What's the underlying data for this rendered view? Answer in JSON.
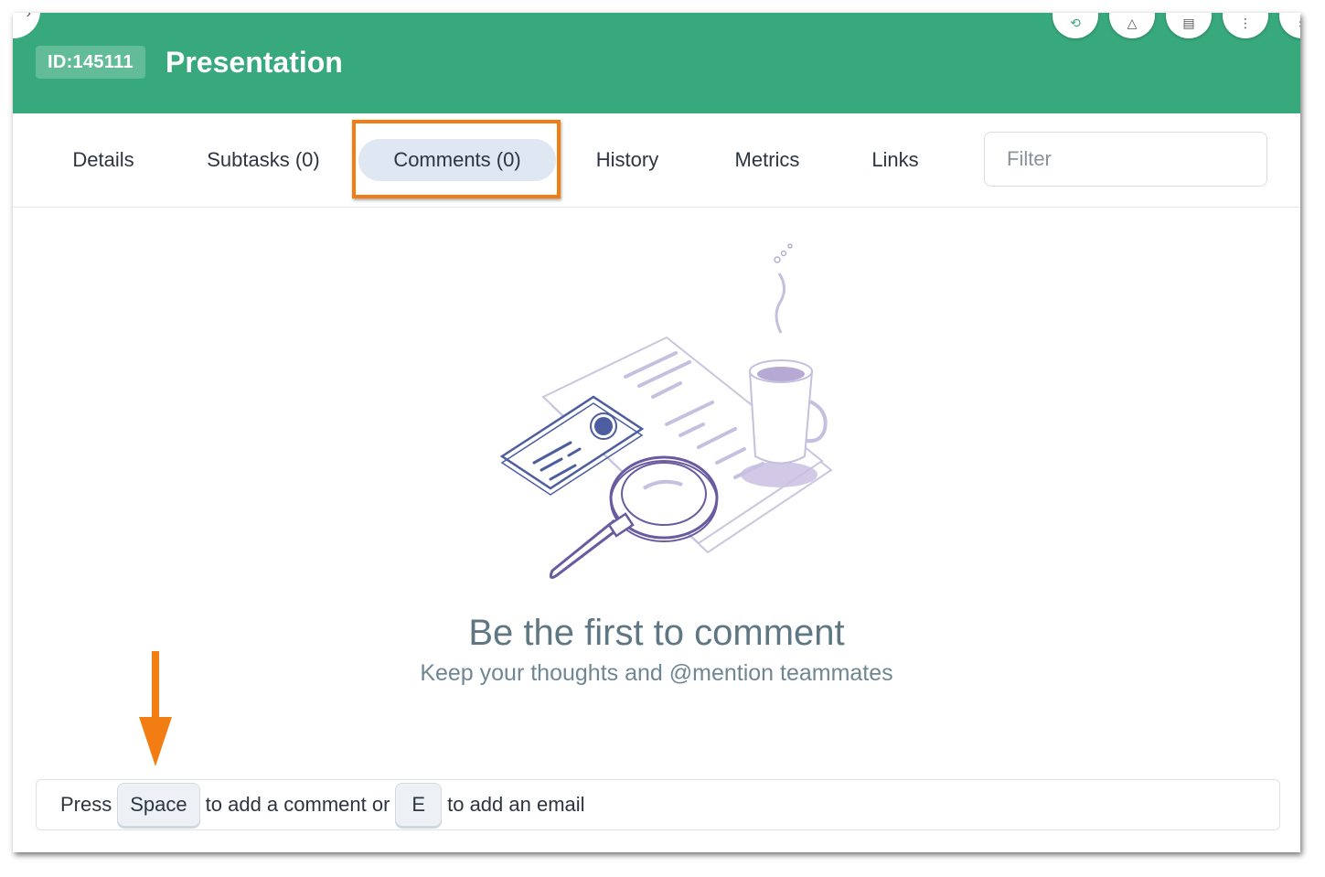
{
  "header": {
    "id_badge": "ID:145111",
    "title": "Presentation",
    "back_icon": "chevron-left-icon",
    "header_icons": [
      "link-icon",
      "bell-icon",
      "columns-icon",
      "more-vertical-icon",
      "close-icon"
    ],
    "color": "#38a97c"
  },
  "tabs": [
    {
      "label": "Details",
      "active": false
    },
    {
      "label": "Subtasks (0)",
      "active": false
    },
    {
      "label": "Comments (0)",
      "active": true
    },
    {
      "label": "History",
      "active": false
    },
    {
      "label": "Metrics",
      "active": false
    },
    {
      "label": "Links",
      "active": false
    }
  ],
  "filter": {
    "placeholder": "Filter",
    "value": ""
  },
  "empty_state": {
    "title": "Be the first to comment",
    "subtitle": "Keep your thoughts and @mention teammates",
    "illustration": "documents-magnifier-coffee-illustration"
  },
  "hint": {
    "press": "Press",
    "key_space": "Space",
    "middle": "to add a comment or",
    "key_e": "E",
    "end": "to add an email"
  },
  "annotations": {
    "highlight_color": "#f27e13",
    "arrow_icon": "arrow-down-icon"
  }
}
